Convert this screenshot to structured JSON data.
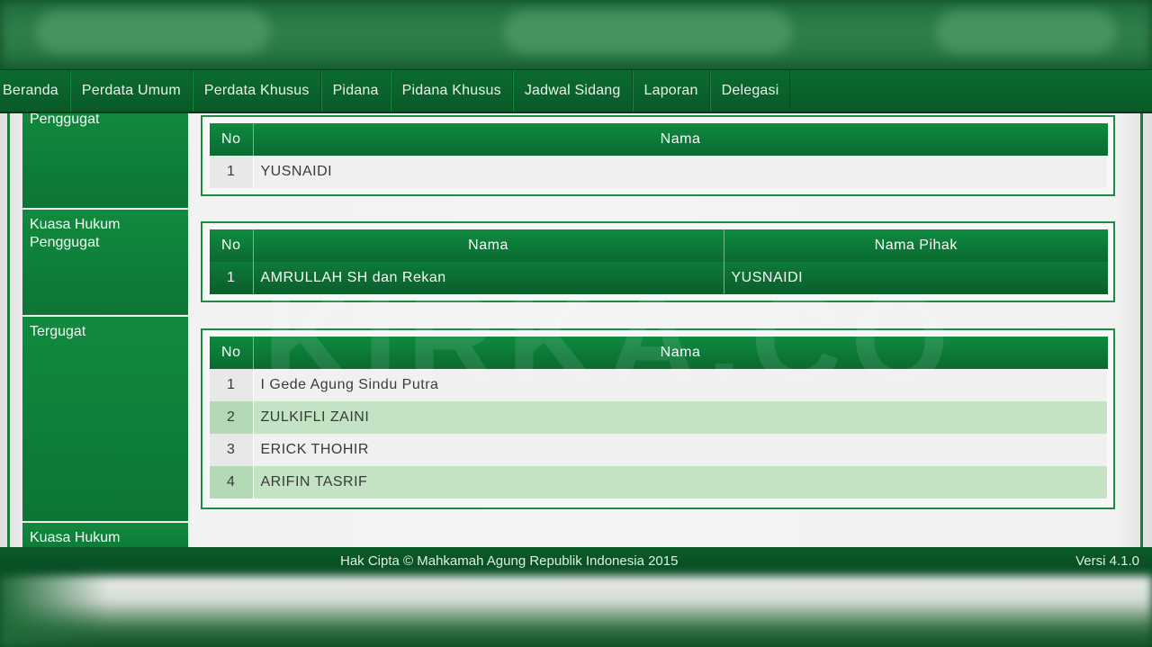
{
  "nav": {
    "items": [
      "Beranda",
      "Perdata Umum",
      "Perdata Khusus",
      "Pidana",
      "Pidana Khusus",
      "Jadwal Sidang",
      "Laporan",
      "Delegasi"
    ]
  },
  "sections": {
    "penggugat": {
      "label": "Penggugat",
      "headers": {
        "no": "No",
        "nama": "Nama"
      },
      "rows": [
        {
          "no": "1",
          "nama": "YUSNAIDI"
        }
      ]
    },
    "kuasa_penggugat": {
      "label": "Kuasa Hukum Penggugat",
      "headers": {
        "no": "No",
        "nama": "Nama",
        "pihak": "Nama Pihak"
      },
      "rows": [
        {
          "no": "1",
          "nama": "AMRULLAH SH dan Rekan",
          "pihak": "YUSNAIDI"
        }
      ]
    },
    "tergugat": {
      "label": "Tergugat",
      "headers": {
        "no": "No",
        "nama": "Nama"
      },
      "rows": [
        {
          "no": "1",
          "nama": "I Gede Agung Sindu Putra"
        },
        {
          "no": "2",
          "nama": "ZULKIFLI ZAINI"
        },
        {
          "no": "3",
          "nama": "ERICK THOHIR"
        },
        {
          "no": "4",
          "nama": "ARIFIN TASRIF"
        }
      ]
    },
    "kuasa_tergugat": {
      "label": "Kuasa Hukum"
    }
  },
  "watermark": "KIRKA.CO",
  "footer": {
    "copyright": "Hak Cipta © Mahkamah Agung Republik Indonesia 2015",
    "version": "Versi 4.1.0"
  },
  "colors": {
    "primary_green": "#0d7536",
    "nav_green": "#0a5a29",
    "alt_row_green": "#c4e3c4"
  }
}
